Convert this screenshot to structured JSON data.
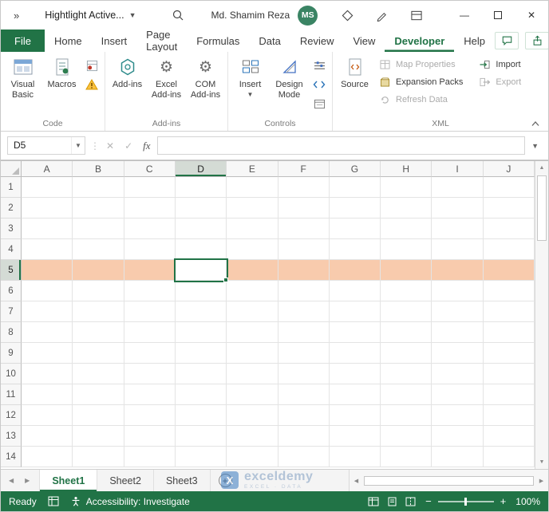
{
  "window": {
    "overflow_chevron": "»",
    "workbook_title": "Hightlight Active...",
    "user_name": "Md. Shamim Reza",
    "avatar_initials": "MS"
  },
  "ribbon": {
    "tabs": [
      "File",
      "Home",
      "Insert",
      "Page Layout",
      "Formulas",
      "Data",
      "Review",
      "View",
      "Developer",
      "Help"
    ],
    "active_tab": "Developer",
    "code": {
      "label": "Code",
      "visual_basic": "Visual Basic",
      "macros": "Macros"
    },
    "addins": {
      "label": "Add-ins",
      "addins": "Add-ins",
      "excel_addins": "Excel Add-ins",
      "com_addins": "COM Add-ins"
    },
    "controls": {
      "label": "Controls",
      "insert": "Insert",
      "design_mode": "Design Mode"
    },
    "xml": {
      "label": "XML",
      "source": "Source",
      "map_properties": "Map Properties",
      "expansion_packs": "Expansion Packs",
      "refresh_data": "Refresh Data",
      "import": "Import",
      "export": "Export"
    }
  },
  "formula_bar": {
    "name_box": "D5",
    "formula": "",
    "fx": "fx"
  },
  "grid": {
    "columns": [
      "A",
      "B",
      "C",
      "D",
      "E",
      "F",
      "G",
      "H",
      "I",
      "J"
    ],
    "row_count": 14,
    "selected_cell": "D5",
    "selected_column": "D",
    "selected_row": 5,
    "highlight_color": "#F8CBAD"
  },
  "sheet_bar": {
    "tabs": [
      "Sheet1",
      "Sheet2",
      "Sheet3"
    ],
    "active_tab": "Sheet1"
  },
  "watermark": {
    "brand": "exceldemy",
    "tagline": "EXCEL · DATA"
  },
  "status_bar": {
    "mode": "Ready",
    "accessibility": "Accessibility: Investigate",
    "zoom_level": "100%"
  }
}
